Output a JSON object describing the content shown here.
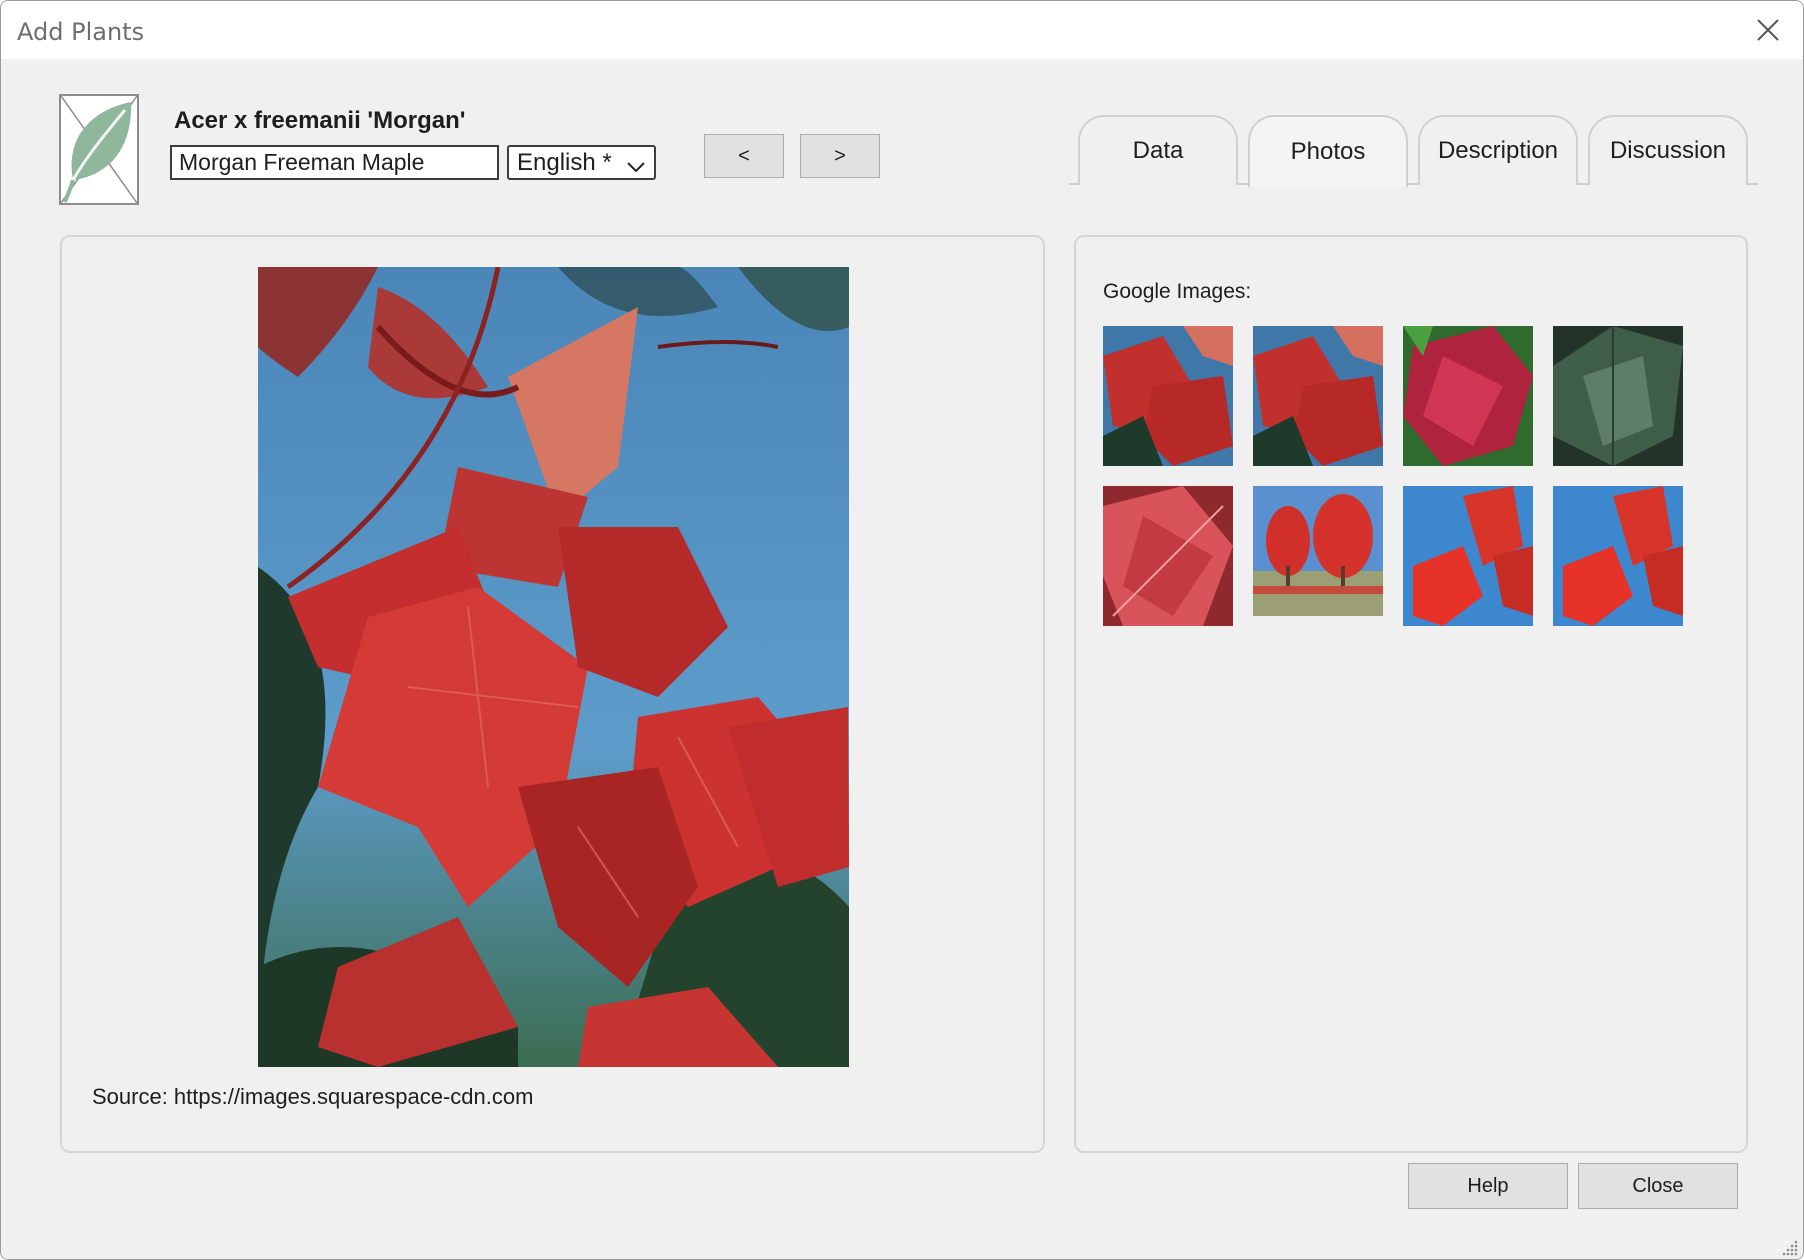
{
  "window": {
    "title": "Add Plants",
    "close_icon": "close-icon"
  },
  "plant": {
    "botanical_name": "Acer x freemanii 'Morgan'",
    "common_name": "Morgan Freeman Maple",
    "language": "English *",
    "icon": "leaf-icon"
  },
  "nav": {
    "prev_label": "<",
    "next_label": ">"
  },
  "tabs": [
    {
      "label": "Data",
      "active": false
    },
    {
      "label": "Photos",
      "active": true
    },
    {
      "label": "Description",
      "active": false
    },
    {
      "label": "Discussion",
      "active": false
    }
  ],
  "photo": {
    "source_label": "Source: https://images.squarespace-cdn.com"
  },
  "google_images": {
    "label": "Google Images:",
    "thumbnails": [
      "red-maple-branch",
      "red-maple-branch",
      "magenta-maple-leaves",
      "green-maple-leaves",
      "red-maple-leaf-closeup",
      "red-maple-trees-field",
      "red-leaves-blue-sky",
      "red-leaves-blue-sky"
    ]
  },
  "footer": {
    "help_label": "Help",
    "close_label": "Close"
  },
  "colors": {
    "window_bg": "#f0f0f0",
    "button_bg": "#e1e1e1",
    "leaf": "#8fb79c",
    "maple_red": "#c8282a",
    "sky": "#4a8ec0"
  }
}
